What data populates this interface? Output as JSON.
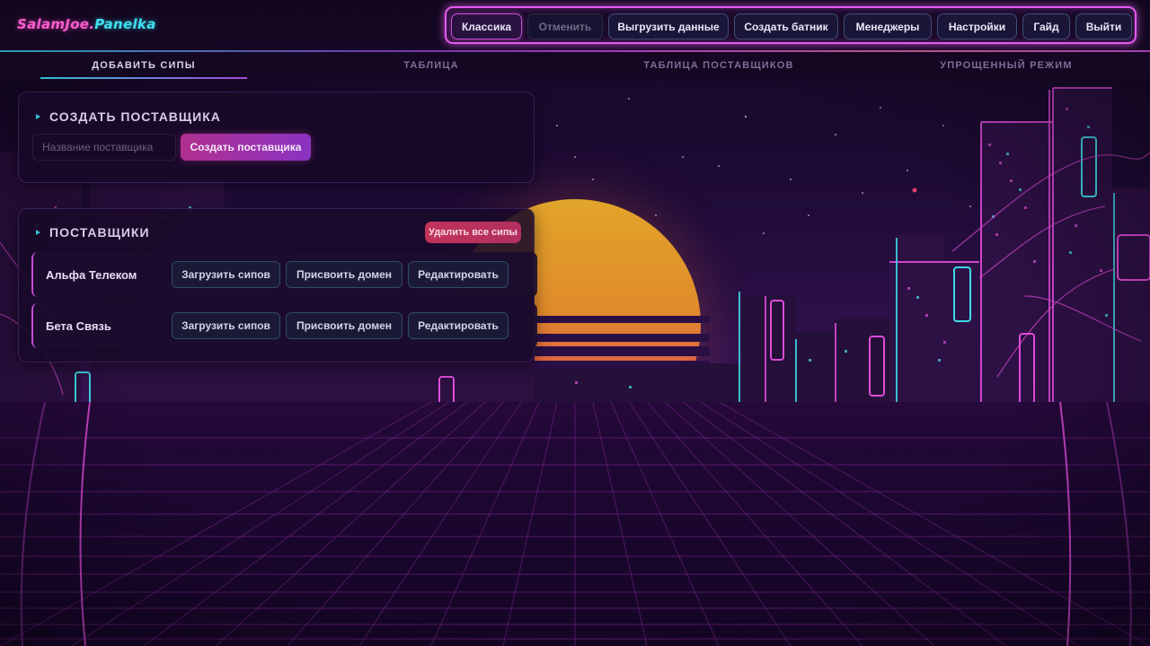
{
  "header": {
    "logo_part1": "SalamJoe.",
    "logo_part2": "Panelka",
    "nav": [
      {
        "label": "Классика",
        "state": "active"
      },
      {
        "label": "Отменить",
        "state": "disabled"
      },
      {
        "label": "Выгрузить данные",
        "state": "normal"
      },
      {
        "label": "Создать батник",
        "state": "normal"
      },
      {
        "label": "Менеджеры",
        "state": "normal"
      },
      {
        "label": "Настройки",
        "state": "normal"
      },
      {
        "label": "Гайд",
        "state": "normal"
      },
      {
        "label": "Выйти",
        "state": "normal"
      }
    ]
  },
  "tabs": [
    {
      "label": "ДОБАВИТЬ СИПЫ",
      "active": true
    },
    {
      "label": "ТАБЛИЦА",
      "active": false
    },
    {
      "label": "ТАБЛИЦА ПОСТАВЩИКОВ",
      "active": false
    },
    {
      "label": "УПРОЩЕННЫЙ РЕЖИМ",
      "active": false
    }
  ],
  "create_panel": {
    "title": "СОЗДАТЬ ПОСТАВЩИКА",
    "input_placeholder": "Название поставщика",
    "input_value": "",
    "submit_label": "Создать поставщика"
  },
  "suppliers_panel": {
    "title": "ПОСТАВЩИКИ",
    "delete_all_label": "Удалить все сипы",
    "rows": [
      {
        "name": "Альфа Телеком",
        "load_label": "Загрузить сипов",
        "assign_label": "Присвоить домен",
        "edit_label": "Редактировать"
      },
      {
        "name": "Бета Связь",
        "load_label": "Загрузить сипов",
        "assign_label": "Присвоить домен",
        "edit_label": "Редактировать"
      }
    ]
  },
  "colors": {
    "accent_pink": "#e25cf0",
    "accent_cyan": "#35c3d6",
    "primary_button": "#b0308f",
    "danger_button": "#c2335a",
    "background": "#12061f"
  }
}
